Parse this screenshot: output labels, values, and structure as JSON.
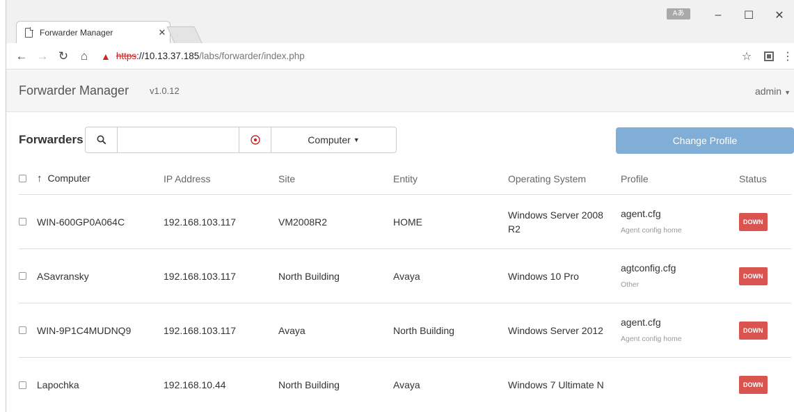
{
  "browser": {
    "ime_label": "Aあ",
    "tab_title": "Forwarder Manager",
    "url_scheme": "https",
    "url_host": "://10.13.37.185",
    "url_path": "/labs/forwarder/index.php"
  },
  "navbar": {
    "brand": "Forwarder Manager",
    "version": "v1.0.12",
    "user": "admin"
  },
  "toolbar": {
    "title": "Forwarders",
    "search_placeholder": "",
    "filter_label": "Computer",
    "change_profile_label": "Change Profile"
  },
  "table": {
    "headers": {
      "computer": "Computer",
      "ip": "IP Address",
      "site": "Site",
      "entity": "Entity",
      "os": "Operating System",
      "profile": "Profile",
      "status": "Status"
    },
    "rows": [
      {
        "computer": "WIN-600GP0A064C",
        "ip": "192.168.103.117",
        "site": "VM2008R2",
        "entity": "HOME",
        "os": "Windows Server 2008 R2",
        "profile": "agent.cfg",
        "profile_desc": "Agent config home",
        "status": "DOWN"
      },
      {
        "computer": "ASavransky",
        "ip": "192.168.103.117",
        "site": "North Building",
        "entity": "Avaya",
        "os": "Windows 10 Pro",
        "profile": "agtconfig.cfg",
        "profile_desc": "Other",
        "status": "DOWN"
      },
      {
        "computer": "WIN-9P1C4MUDNQ9",
        "ip": "192.168.103.117",
        "site": "Avaya",
        "entity": "North Building",
        "os": "Windows Server 2012",
        "profile": "agent.cfg",
        "profile_desc": "Agent config home",
        "status": "DOWN"
      },
      {
        "computer": "Lapochka",
        "ip": "192.168.10.44",
        "site": "North Building",
        "entity": "Avaya",
        "os": "Windows 7 Ultimate N",
        "profile": "",
        "profile_desc": "",
        "status": "DOWN"
      }
    ]
  },
  "colors": {
    "status_down": "#d9534f",
    "primary_button": "#80aed6",
    "insecure_red": "#c62828"
  }
}
